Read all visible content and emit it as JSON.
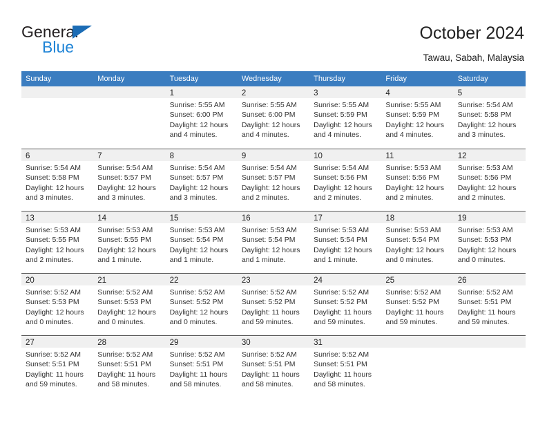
{
  "brand": {
    "name_dark": "General",
    "name_blue": "Blue",
    "accent_blue": "#1f84d6",
    "triangle_blue": "#1b6cb5"
  },
  "header": {
    "title": "October 2024",
    "subtitle": "Tawau, Sabah, Malaysia"
  },
  "calendar": {
    "header_bg": "#3b7dc0",
    "daynum_bg": "#f0f0f0",
    "weekdays": [
      "Sunday",
      "Monday",
      "Tuesday",
      "Wednesday",
      "Thursday",
      "Friday",
      "Saturday"
    ],
    "weeks": [
      [
        {
          "day": "",
          "empty": true,
          "sunrise": "",
          "sunset": "",
          "daylight1": "",
          "daylight2": ""
        },
        {
          "day": "",
          "empty": true,
          "sunrise": "",
          "sunset": "",
          "daylight1": "",
          "daylight2": ""
        },
        {
          "day": "1",
          "empty": false,
          "sunrise": "Sunrise: 5:55 AM",
          "sunset": "Sunset: 6:00 PM",
          "daylight1": "Daylight: 12 hours",
          "daylight2": "and 4 minutes."
        },
        {
          "day": "2",
          "empty": false,
          "sunrise": "Sunrise: 5:55 AM",
          "sunset": "Sunset: 6:00 PM",
          "daylight1": "Daylight: 12 hours",
          "daylight2": "and 4 minutes."
        },
        {
          "day": "3",
          "empty": false,
          "sunrise": "Sunrise: 5:55 AM",
          "sunset": "Sunset: 5:59 PM",
          "daylight1": "Daylight: 12 hours",
          "daylight2": "and 4 minutes."
        },
        {
          "day": "4",
          "empty": false,
          "sunrise": "Sunrise: 5:55 AM",
          "sunset": "Sunset: 5:59 PM",
          "daylight1": "Daylight: 12 hours",
          "daylight2": "and 4 minutes."
        },
        {
          "day": "5",
          "empty": false,
          "sunrise": "Sunrise: 5:54 AM",
          "sunset": "Sunset: 5:58 PM",
          "daylight1": "Daylight: 12 hours",
          "daylight2": "and 3 minutes."
        }
      ],
      [
        {
          "day": "6",
          "empty": false,
          "sunrise": "Sunrise: 5:54 AM",
          "sunset": "Sunset: 5:58 PM",
          "daylight1": "Daylight: 12 hours",
          "daylight2": "and 3 minutes."
        },
        {
          "day": "7",
          "empty": false,
          "sunrise": "Sunrise: 5:54 AM",
          "sunset": "Sunset: 5:57 PM",
          "daylight1": "Daylight: 12 hours",
          "daylight2": "and 3 minutes."
        },
        {
          "day": "8",
          "empty": false,
          "sunrise": "Sunrise: 5:54 AM",
          "sunset": "Sunset: 5:57 PM",
          "daylight1": "Daylight: 12 hours",
          "daylight2": "and 3 minutes."
        },
        {
          "day": "9",
          "empty": false,
          "sunrise": "Sunrise: 5:54 AM",
          "sunset": "Sunset: 5:57 PM",
          "daylight1": "Daylight: 12 hours",
          "daylight2": "and 2 minutes."
        },
        {
          "day": "10",
          "empty": false,
          "sunrise": "Sunrise: 5:54 AM",
          "sunset": "Sunset: 5:56 PM",
          "daylight1": "Daylight: 12 hours",
          "daylight2": "and 2 minutes."
        },
        {
          "day": "11",
          "empty": false,
          "sunrise": "Sunrise: 5:53 AM",
          "sunset": "Sunset: 5:56 PM",
          "daylight1": "Daylight: 12 hours",
          "daylight2": "and 2 minutes."
        },
        {
          "day": "12",
          "empty": false,
          "sunrise": "Sunrise: 5:53 AM",
          "sunset": "Sunset: 5:56 PM",
          "daylight1": "Daylight: 12 hours",
          "daylight2": "and 2 minutes."
        }
      ],
      [
        {
          "day": "13",
          "empty": false,
          "sunrise": "Sunrise: 5:53 AM",
          "sunset": "Sunset: 5:55 PM",
          "daylight1": "Daylight: 12 hours",
          "daylight2": "and 2 minutes."
        },
        {
          "day": "14",
          "empty": false,
          "sunrise": "Sunrise: 5:53 AM",
          "sunset": "Sunset: 5:55 PM",
          "daylight1": "Daylight: 12 hours",
          "daylight2": "and 1 minute."
        },
        {
          "day": "15",
          "empty": false,
          "sunrise": "Sunrise: 5:53 AM",
          "sunset": "Sunset: 5:54 PM",
          "daylight1": "Daylight: 12 hours",
          "daylight2": "and 1 minute."
        },
        {
          "day": "16",
          "empty": false,
          "sunrise": "Sunrise: 5:53 AM",
          "sunset": "Sunset: 5:54 PM",
          "daylight1": "Daylight: 12 hours",
          "daylight2": "and 1 minute."
        },
        {
          "day": "17",
          "empty": false,
          "sunrise": "Sunrise: 5:53 AM",
          "sunset": "Sunset: 5:54 PM",
          "daylight1": "Daylight: 12 hours",
          "daylight2": "and 1 minute."
        },
        {
          "day": "18",
          "empty": false,
          "sunrise": "Sunrise: 5:53 AM",
          "sunset": "Sunset: 5:54 PM",
          "daylight1": "Daylight: 12 hours",
          "daylight2": "and 0 minutes."
        },
        {
          "day": "19",
          "empty": false,
          "sunrise": "Sunrise: 5:53 AM",
          "sunset": "Sunset: 5:53 PM",
          "daylight1": "Daylight: 12 hours",
          "daylight2": "and 0 minutes."
        }
      ],
      [
        {
          "day": "20",
          "empty": false,
          "sunrise": "Sunrise: 5:52 AM",
          "sunset": "Sunset: 5:53 PM",
          "daylight1": "Daylight: 12 hours",
          "daylight2": "and 0 minutes."
        },
        {
          "day": "21",
          "empty": false,
          "sunrise": "Sunrise: 5:52 AM",
          "sunset": "Sunset: 5:53 PM",
          "daylight1": "Daylight: 12 hours",
          "daylight2": "and 0 minutes."
        },
        {
          "day": "22",
          "empty": false,
          "sunrise": "Sunrise: 5:52 AM",
          "sunset": "Sunset: 5:52 PM",
          "daylight1": "Daylight: 12 hours",
          "daylight2": "and 0 minutes."
        },
        {
          "day": "23",
          "empty": false,
          "sunrise": "Sunrise: 5:52 AM",
          "sunset": "Sunset: 5:52 PM",
          "daylight1": "Daylight: 11 hours",
          "daylight2": "and 59 minutes."
        },
        {
          "day": "24",
          "empty": false,
          "sunrise": "Sunrise: 5:52 AM",
          "sunset": "Sunset: 5:52 PM",
          "daylight1": "Daylight: 11 hours",
          "daylight2": "and 59 minutes."
        },
        {
          "day": "25",
          "empty": false,
          "sunrise": "Sunrise: 5:52 AM",
          "sunset": "Sunset: 5:52 PM",
          "daylight1": "Daylight: 11 hours",
          "daylight2": "and 59 minutes."
        },
        {
          "day": "26",
          "empty": false,
          "sunrise": "Sunrise: 5:52 AM",
          "sunset": "Sunset: 5:51 PM",
          "daylight1": "Daylight: 11 hours",
          "daylight2": "and 59 minutes."
        }
      ],
      [
        {
          "day": "27",
          "empty": false,
          "sunrise": "Sunrise: 5:52 AM",
          "sunset": "Sunset: 5:51 PM",
          "daylight1": "Daylight: 11 hours",
          "daylight2": "and 59 minutes."
        },
        {
          "day": "28",
          "empty": false,
          "sunrise": "Sunrise: 5:52 AM",
          "sunset": "Sunset: 5:51 PM",
          "daylight1": "Daylight: 11 hours",
          "daylight2": "and 58 minutes."
        },
        {
          "day": "29",
          "empty": false,
          "sunrise": "Sunrise: 5:52 AM",
          "sunset": "Sunset: 5:51 PM",
          "daylight1": "Daylight: 11 hours",
          "daylight2": "and 58 minutes."
        },
        {
          "day": "30",
          "empty": false,
          "sunrise": "Sunrise: 5:52 AM",
          "sunset": "Sunset: 5:51 PM",
          "daylight1": "Daylight: 11 hours",
          "daylight2": "and 58 minutes."
        },
        {
          "day": "31",
          "empty": false,
          "sunrise": "Sunrise: 5:52 AM",
          "sunset": "Sunset: 5:51 PM",
          "daylight1": "Daylight: 11 hours",
          "daylight2": "and 58 minutes."
        },
        {
          "day": "",
          "empty": true,
          "sunrise": "",
          "sunset": "",
          "daylight1": "",
          "daylight2": ""
        },
        {
          "day": "",
          "empty": true,
          "sunrise": "",
          "sunset": "",
          "daylight1": "",
          "daylight2": ""
        }
      ]
    ]
  }
}
